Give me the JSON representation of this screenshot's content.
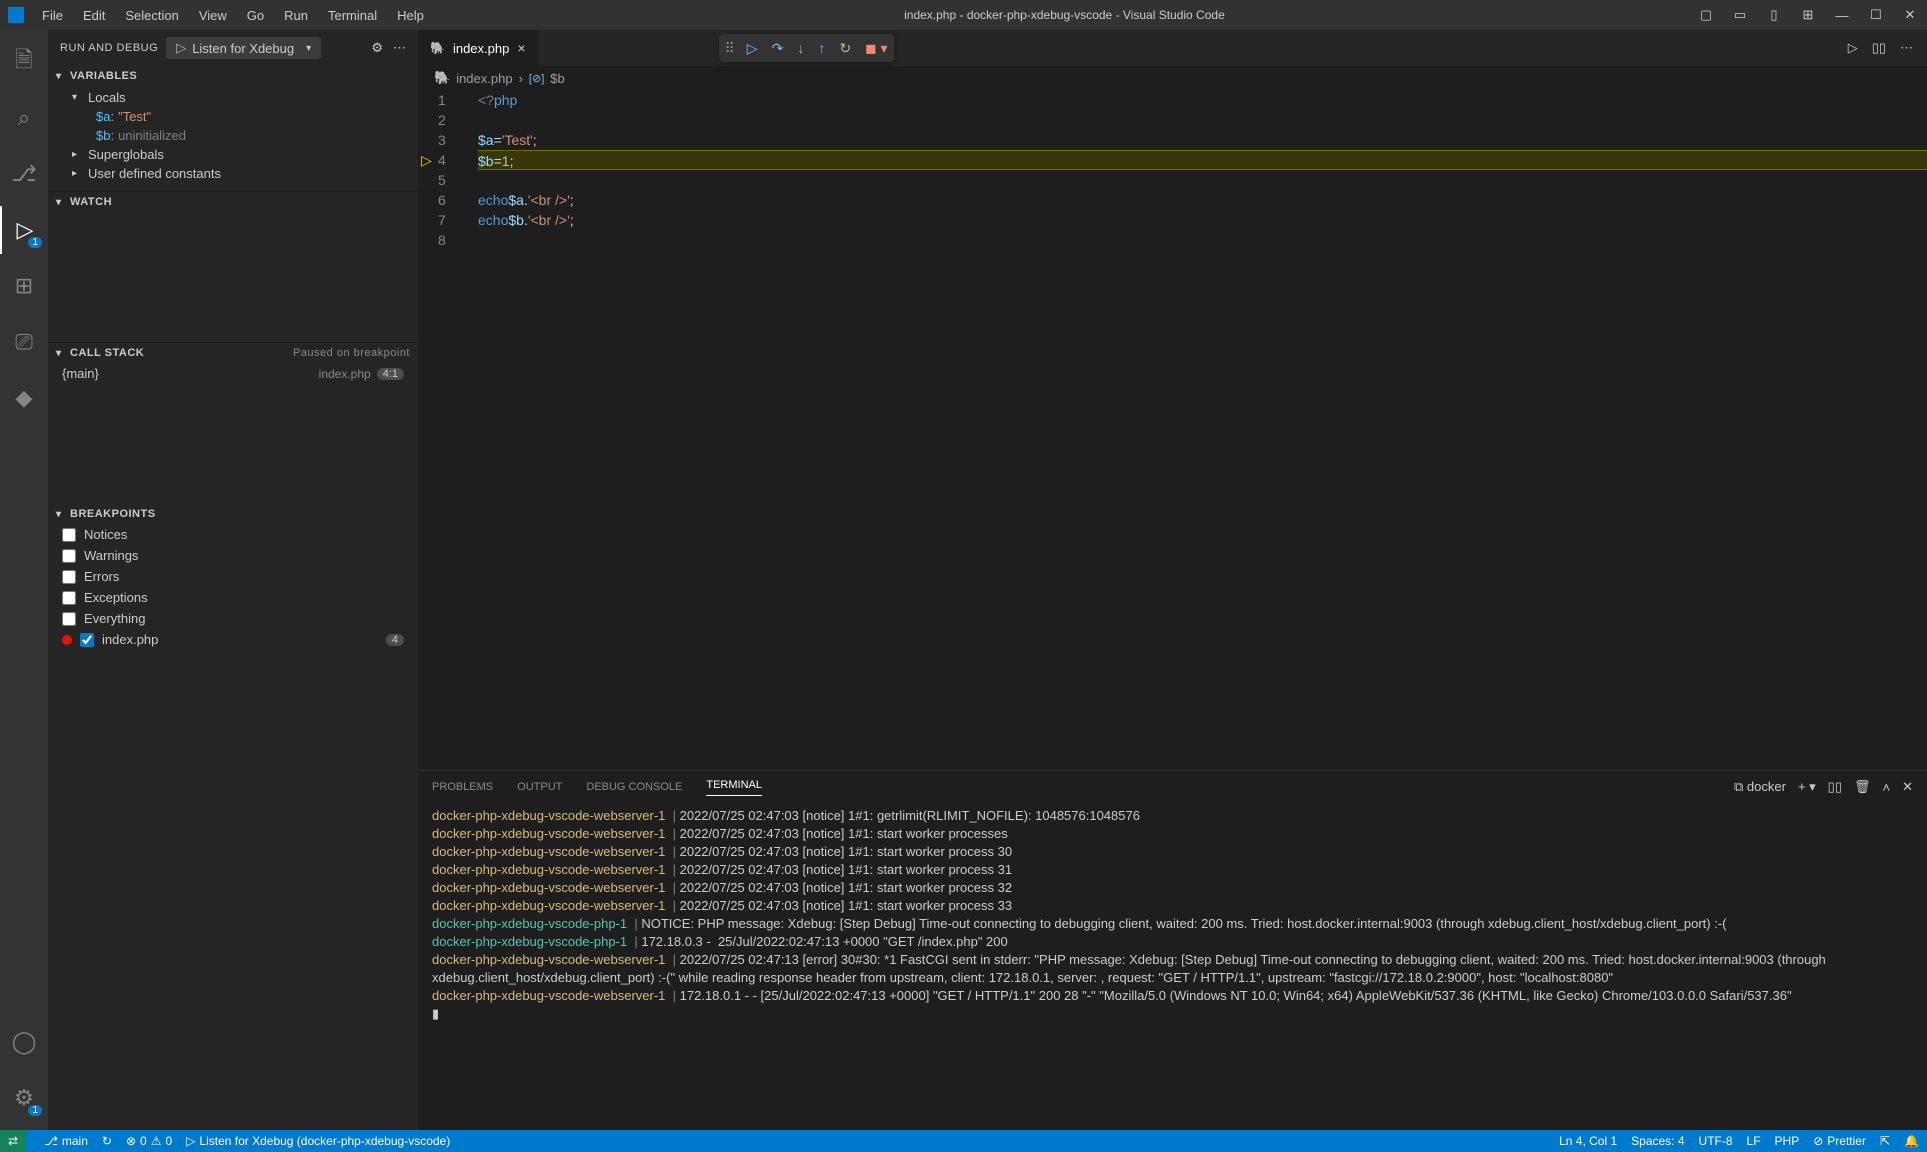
{
  "titlebar": {
    "menus": [
      "File",
      "Edit",
      "Selection",
      "View",
      "Go",
      "Run",
      "Terminal",
      "Help"
    ],
    "title": "index.php - docker-php-xdebug-vscode - Visual Studio Code"
  },
  "activitybar": {
    "debug_badge": "1",
    "settings_badge": "1"
  },
  "rundebug": {
    "header": "RUN AND DEBUG",
    "config": "Listen for Xdebug"
  },
  "variables": {
    "title": "VARIABLES",
    "locals_label": "Locals",
    "vars": [
      {
        "name": "$a:",
        "value": "\"Test\"",
        "kind": "str"
      },
      {
        "name": "$b:",
        "value": "uninitialized",
        "kind": "un"
      }
    ],
    "supers": "Superglobals",
    "consts": "User defined constants"
  },
  "watch": {
    "title": "WATCH"
  },
  "callstack": {
    "title": "CALL STACK",
    "status": "Paused on breakpoint",
    "frame": "{main}",
    "file": "index.php",
    "pos": "4:1"
  },
  "breakpoints": {
    "title": "BREAKPOINTS",
    "items": [
      {
        "label": "Notices",
        "checked": false
      },
      {
        "label": "Warnings",
        "checked": false
      },
      {
        "label": "Errors",
        "checked": false
      },
      {
        "label": "Exceptions",
        "checked": false
      },
      {
        "label": "Everything",
        "checked": false
      }
    ],
    "file_bp": {
      "label": "index.php",
      "count": "4"
    }
  },
  "editor": {
    "tab_name": "index.php",
    "breadcrumb_file": "index.php",
    "breadcrumb_sym": "$b",
    "lines": [
      {
        "n": "1",
        "tokens": [
          {
            "t": "<?",
            "c": "tok-tag"
          },
          {
            "t": "php",
            "c": "tok-kw"
          }
        ]
      },
      {
        "n": "2",
        "tokens": []
      },
      {
        "n": "3",
        "tokens": [
          {
            "t": "$a",
            "c": "tok-var"
          },
          {
            "t": " = ",
            "c": "tok-op"
          },
          {
            "t": "'Test'",
            "c": "tok-str"
          },
          {
            "t": ";",
            "c": "tok-op"
          }
        ]
      },
      {
        "n": "4",
        "hl": true,
        "bp": true,
        "tokens": [
          {
            "t": "$b",
            "c": "tok-var"
          },
          {
            "t": " = ",
            "c": "tok-op"
          },
          {
            "t": "1",
            "c": "tok-num"
          },
          {
            "t": ";",
            "c": "tok-op"
          }
        ]
      },
      {
        "n": "5",
        "tokens": []
      },
      {
        "n": "6",
        "tokens": [
          {
            "t": "echo",
            "c": "tok-kw"
          },
          {
            "t": " ",
            "c": ""
          },
          {
            "t": "$a",
            "c": "tok-var"
          },
          {
            "t": " . ",
            "c": "tok-op"
          },
          {
            "t": "'<br />'",
            "c": "tok-str"
          },
          {
            "t": ";",
            "c": "tok-op"
          }
        ]
      },
      {
        "n": "7",
        "tokens": [
          {
            "t": "echo",
            "c": "tok-kw"
          },
          {
            "t": " ",
            "c": ""
          },
          {
            "t": "$b",
            "c": "tok-var"
          },
          {
            "t": " . ",
            "c": "tok-op"
          },
          {
            "t": "'<br />'",
            "c": "tok-str"
          },
          {
            "t": ";",
            "c": "tok-op"
          }
        ]
      },
      {
        "n": "8",
        "tokens": []
      }
    ]
  },
  "panel": {
    "tabs": [
      "PROBLEMS",
      "OUTPUT",
      "DEBUG CONSOLE",
      "TERMINAL"
    ],
    "active": 3,
    "shell_label": "docker",
    "lines": [
      {
        "c": "docker-php-xdebug-vscode-webserver-1",
        "cc": "",
        "t": "2022/07/25 02:47:03 [notice] 1#1: getrlimit(RLIMIT_NOFILE): 1048576:1048576"
      },
      {
        "c": "docker-php-xdebug-vscode-webserver-1",
        "cc": "",
        "t": "2022/07/25 02:47:03 [notice] 1#1: start worker processes"
      },
      {
        "c": "docker-php-xdebug-vscode-webserver-1",
        "cc": "",
        "t": "2022/07/25 02:47:03 [notice] 1#1: start worker process 30"
      },
      {
        "c": "docker-php-xdebug-vscode-webserver-1",
        "cc": "",
        "t": "2022/07/25 02:47:03 [notice] 1#1: start worker process 31"
      },
      {
        "c": "docker-php-xdebug-vscode-webserver-1",
        "cc": "",
        "t": "2022/07/25 02:47:03 [notice] 1#1: start worker process 32"
      },
      {
        "c": "docker-php-xdebug-vscode-webserver-1",
        "cc": "",
        "t": "2022/07/25 02:47:03 [notice] 1#1: start worker process 33"
      },
      {
        "c": "docker-php-xdebug-vscode-php-1",
        "cc": "blue",
        "t": "NOTICE: PHP message: Xdebug: [Step Debug] Time-out connecting to debugging client, waited: 200 ms. Tried: host.docker.internal:9003 (through xdebug.client_host/xdebug.client_port) :-("
      },
      {
        "c": "docker-php-xdebug-vscode-php-1",
        "cc": "blue",
        "t": "172.18.0.3 -  25/Jul/2022:02:47:13 +0000 \"GET /index.php\" 200"
      },
      {
        "c": "docker-php-xdebug-vscode-webserver-1",
        "cc": "",
        "t": "2022/07/25 02:47:13 [error] 30#30: *1 FastCGI sent in stderr: \"PHP message: Xdebug: [Step Debug] Time-out connecting to debugging client, waited: 200 ms. Tried: host.docker.internal:9003 (through xdebug.client_host/xdebug.client_port) :-(\" while reading response header from upstream, client: 172.18.0.1, server: , request: \"GET / HTTP/1.1\", upstream: \"fastcgi://172.18.0.2:9000\", host: \"localhost:8080\""
      },
      {
        "c": "docker-php-xdebug-vscode-webserver-1",
        "cc": "",
        "t": "172.18.0.1 - - [25/Jul/2022:02:47:13 +0000] \"GET / HTTP/1.1\" 200 28 \"-\" \"Mozilla/5.0 (Windows NT 10.0; Win64; x64) AppleWebKit/537.36 (KHTML, like Gecko) Chrome/103.0.0.0 Safari/537.36\""
      }
    ]
  },
  "statusbar": {
    "branch": "main",
    "errors": "0",
    "warnings": "0",
    "debug": "Listen for Xdebug (docker-php-xdebug-vscode)",
    "lncol": "Ln 4, Col 1",
    "spaces": "Spaces: 4",
    "encoding": "UTF-8",
    "eol": "LF",
    "lang": "PHP",
    "prettier": "Prettier"
  }
}
